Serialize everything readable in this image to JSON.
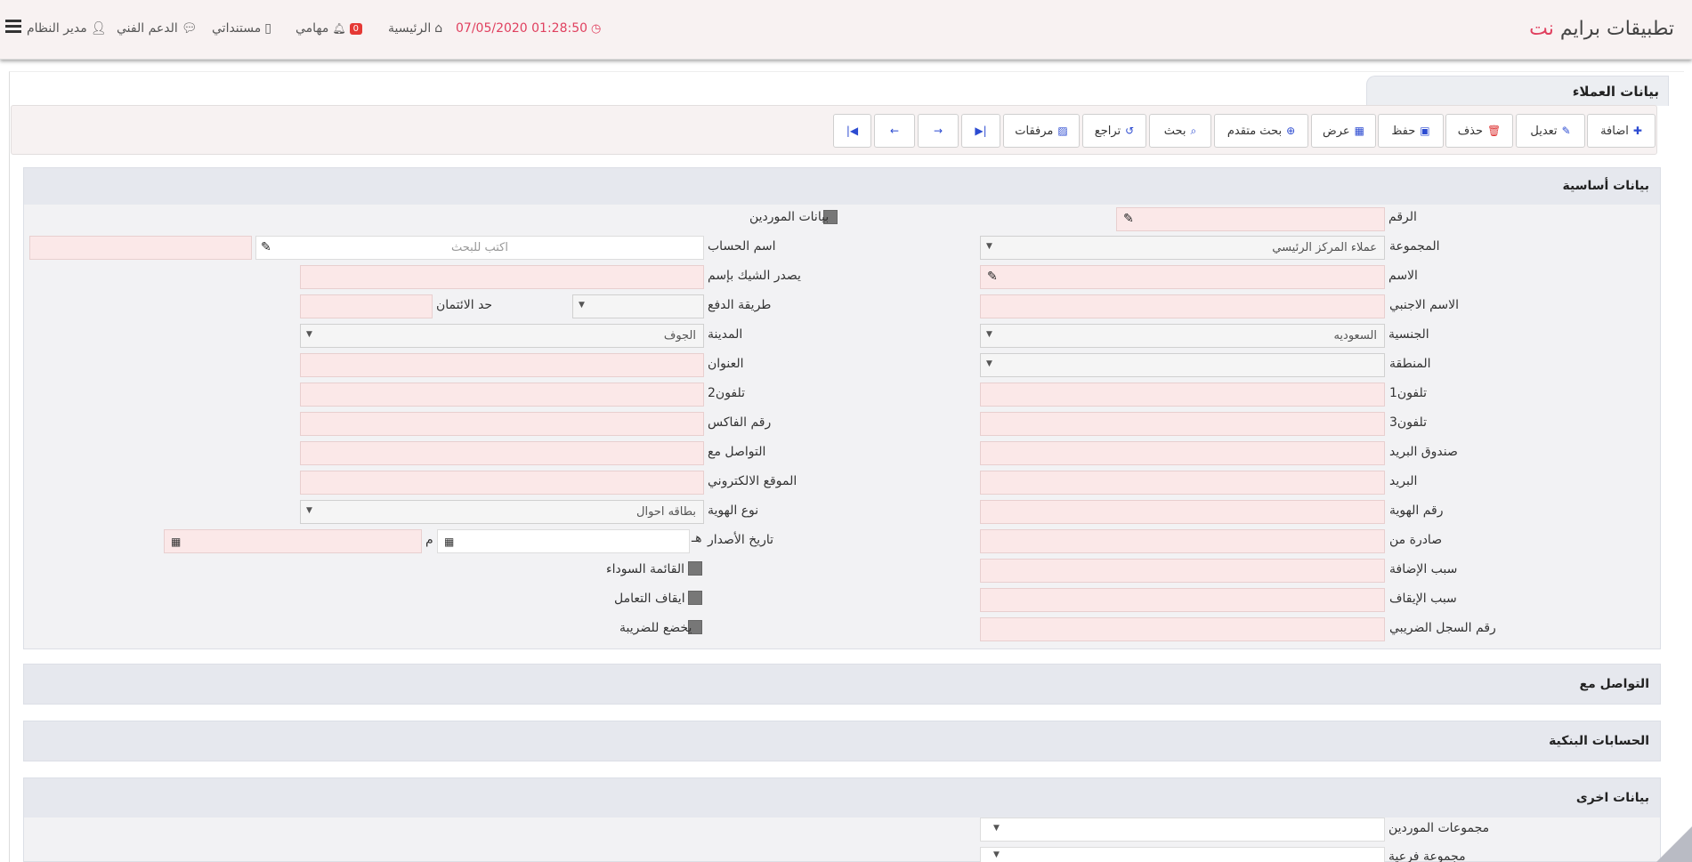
{
  "header": {
    "brand_main": "تطبيقات برايم",
    "brand_accent": "نت",
    "datetime": "07/05/2020 01:28:50",
    "home": "الرئيسية",
    "tasks_badge": "0",
    "tasks": "مهامي",
    "documents": "مستنداتي",
    "support": "الدعم الفني",
    "user": "مدير النظام"
  },
  "page": {
    "tab_title": "بيانات العملاء"
  },
  "toolbar": {
    "add": "اضافة",
    "edit": "تعديل",
    "delete": "حذف",
    "save": "حفظ",
    "view": "عرض",
    "adv_search": "بحث متقدم",
    "search": "بحث",
    "undo": "تراجع",
    "attachments": "مرفقات"
  },
  "sections": {
    "basic": "بيانات أساسية",
    "contact": "التواصل مع",
    "bank": "الحسابات البنكية",
    "other": "بيانات اخرى"
  },
  "form": {
    "number": "الرقم",
    "suppliers_data": "بيانات الموردين",
    "group": "المجموعة",
    "group_value": "عملاء المركز الرئيسي",
    "account_name": "اسم الحساب",
    "search_placeholder": "اكتب للبحث",
    "name": "الاسم",
    "cheque_issuer": "يصدر الشيك بإسم",
    "foreign_name": "الاسم الاجنبي",
    "payment_method": "طريقة الدفع",
    "credit_limit": "حد الائتمان",
    "nationality": "الجنسية",
    "nationality_value": "السعوديه",
    "city": "المدينة",
    "city_value": "الجوف",
    "region": "المنطقة",
    "address": "العنوان",
    "phone1": "تلفون1",
    "phone2": "تلفون2",
    "phone3": "تلفون3",
    "fax": "رقم الفاكس",
    "po_box": "صندوق البريد",
    "contact_with": "التواصل مع",
    "email": "البريد",
    "website": "الموقع الالكتروني",
    "id_number": "رقم الهوية",
    "id_type": "نوع الهوية",
    "id_type_value": "بطاقه احوال",
    "issued_from": "صادرة من",
    "issue_date": "تاريخ الأصدار",
    "hijri_suffix": "هـ",
    "greg_suffix": "م",
    "add_reason": "سبب الإضافة",
    "blacklist": "القائمة السوداء",
    "stop_reason": "سبب الإيقاف",
    "stop_dealing": "ايقاف التعامل",
    "tax_reg_number": "رقم السجل الضريبي",
    "taxable": "يخضع للضريبة",
    "supplier_groups": "مجموعات الموردين",
    "sub_group": "مجموعة فرعية"
  }
}
